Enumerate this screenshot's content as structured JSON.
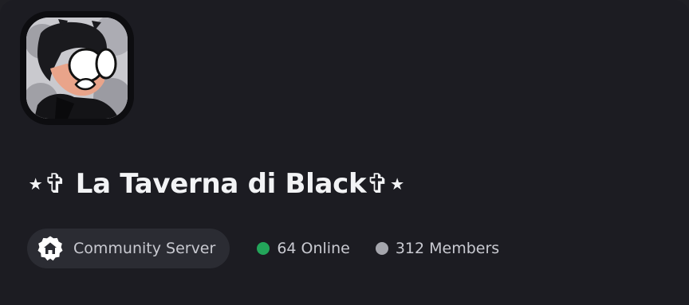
{
  "server": {
    "name": "⋆✞ La Taverna di Black✞⋆",
    "avatar_icon": "server-avatar-icon"
  },
  "badges": {
    "community_label": "Community Server",
    "community_icon": "community-house-icon"
  },
  "counts": {
    "online_label": "64 Online",
    "members_label": "312 Members"
  },
  "colors": {
    "online_dot": "#23a55a",
    "members_dot": "#a5a6ad",
    "background": "#1c1c22",
    "pill": "#2b2c33"
  }
}
